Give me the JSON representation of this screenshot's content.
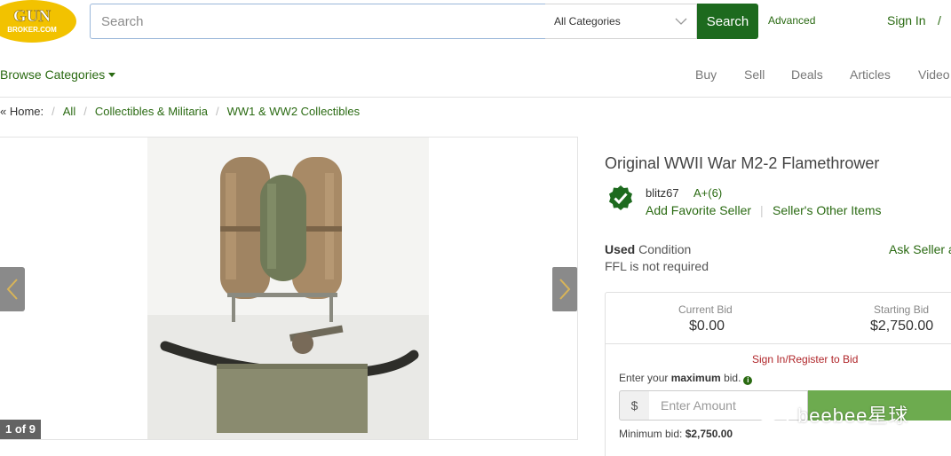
{
  "header": {
    "logo_text_main": "GUN",
    "logo_text_sub": "BROKER.COM",
    "search_placeholder": "Search",
    "category_selected": "All Categories",
    "search_button": "Search",
    "advanced_link": "Advanced",
    "sign_in": "Sign In",
    "slash": "/"
  },
  "nav": {
    "browse": "Browse Categories",
    "links": [
      "Buy",
      "Sell",
      "Deals",
      "Articles",
      "Video"
    ]
  },
  "breadcrumb": {
    "home": "« Home:",
    "items": [
      "All",
      "Collectibles & Militaria",
      "WW1 & WW2 Collectibles"
    ]
  },
  "gallery": {
    "counter": "1 of 9"
  },
  "item": {
    "title": "Original WWII War M2-2 Flamethrower",
    "seller_name": "blitz67",
    "seller_rating": "A+(6)",
    "add_favorite": "Add Favorite Seller",
    "other_items": "Seller's Other Items",
    "condition_bold": "Used",
    "condition_text": " Condition",
    "ffl": "FFL is not required",
    "ask_seller": "Ask Seller a"
  },
  "bid": {
    "current_label": "Current Bid",
    "current_value": "$0.00",
    "starting_label": "Starting Bid",
    "starting_value": "$2,750.00",
    "sign_register": "Sign In/Register to Bid",
    "enter_prefix": "Enter your ",
    "enter_bold": "maximum",
    "enter_suffix": " bid.",
    "currency": "$",
    "amount_placeholder": "Enter Amount",
    "min_prefix": "Minimum bid: ",
    "min_value": "$2,750.00"
  },
  "watermark": {
    "text": "beebee星球"
  },
  "colors": {
    "brand_green": "#1d6a1e",
    "link_green": "#2a6a12",
    "bid_button": "#6dab4f",
    "alert_red": "#b0262a"
  }
}
